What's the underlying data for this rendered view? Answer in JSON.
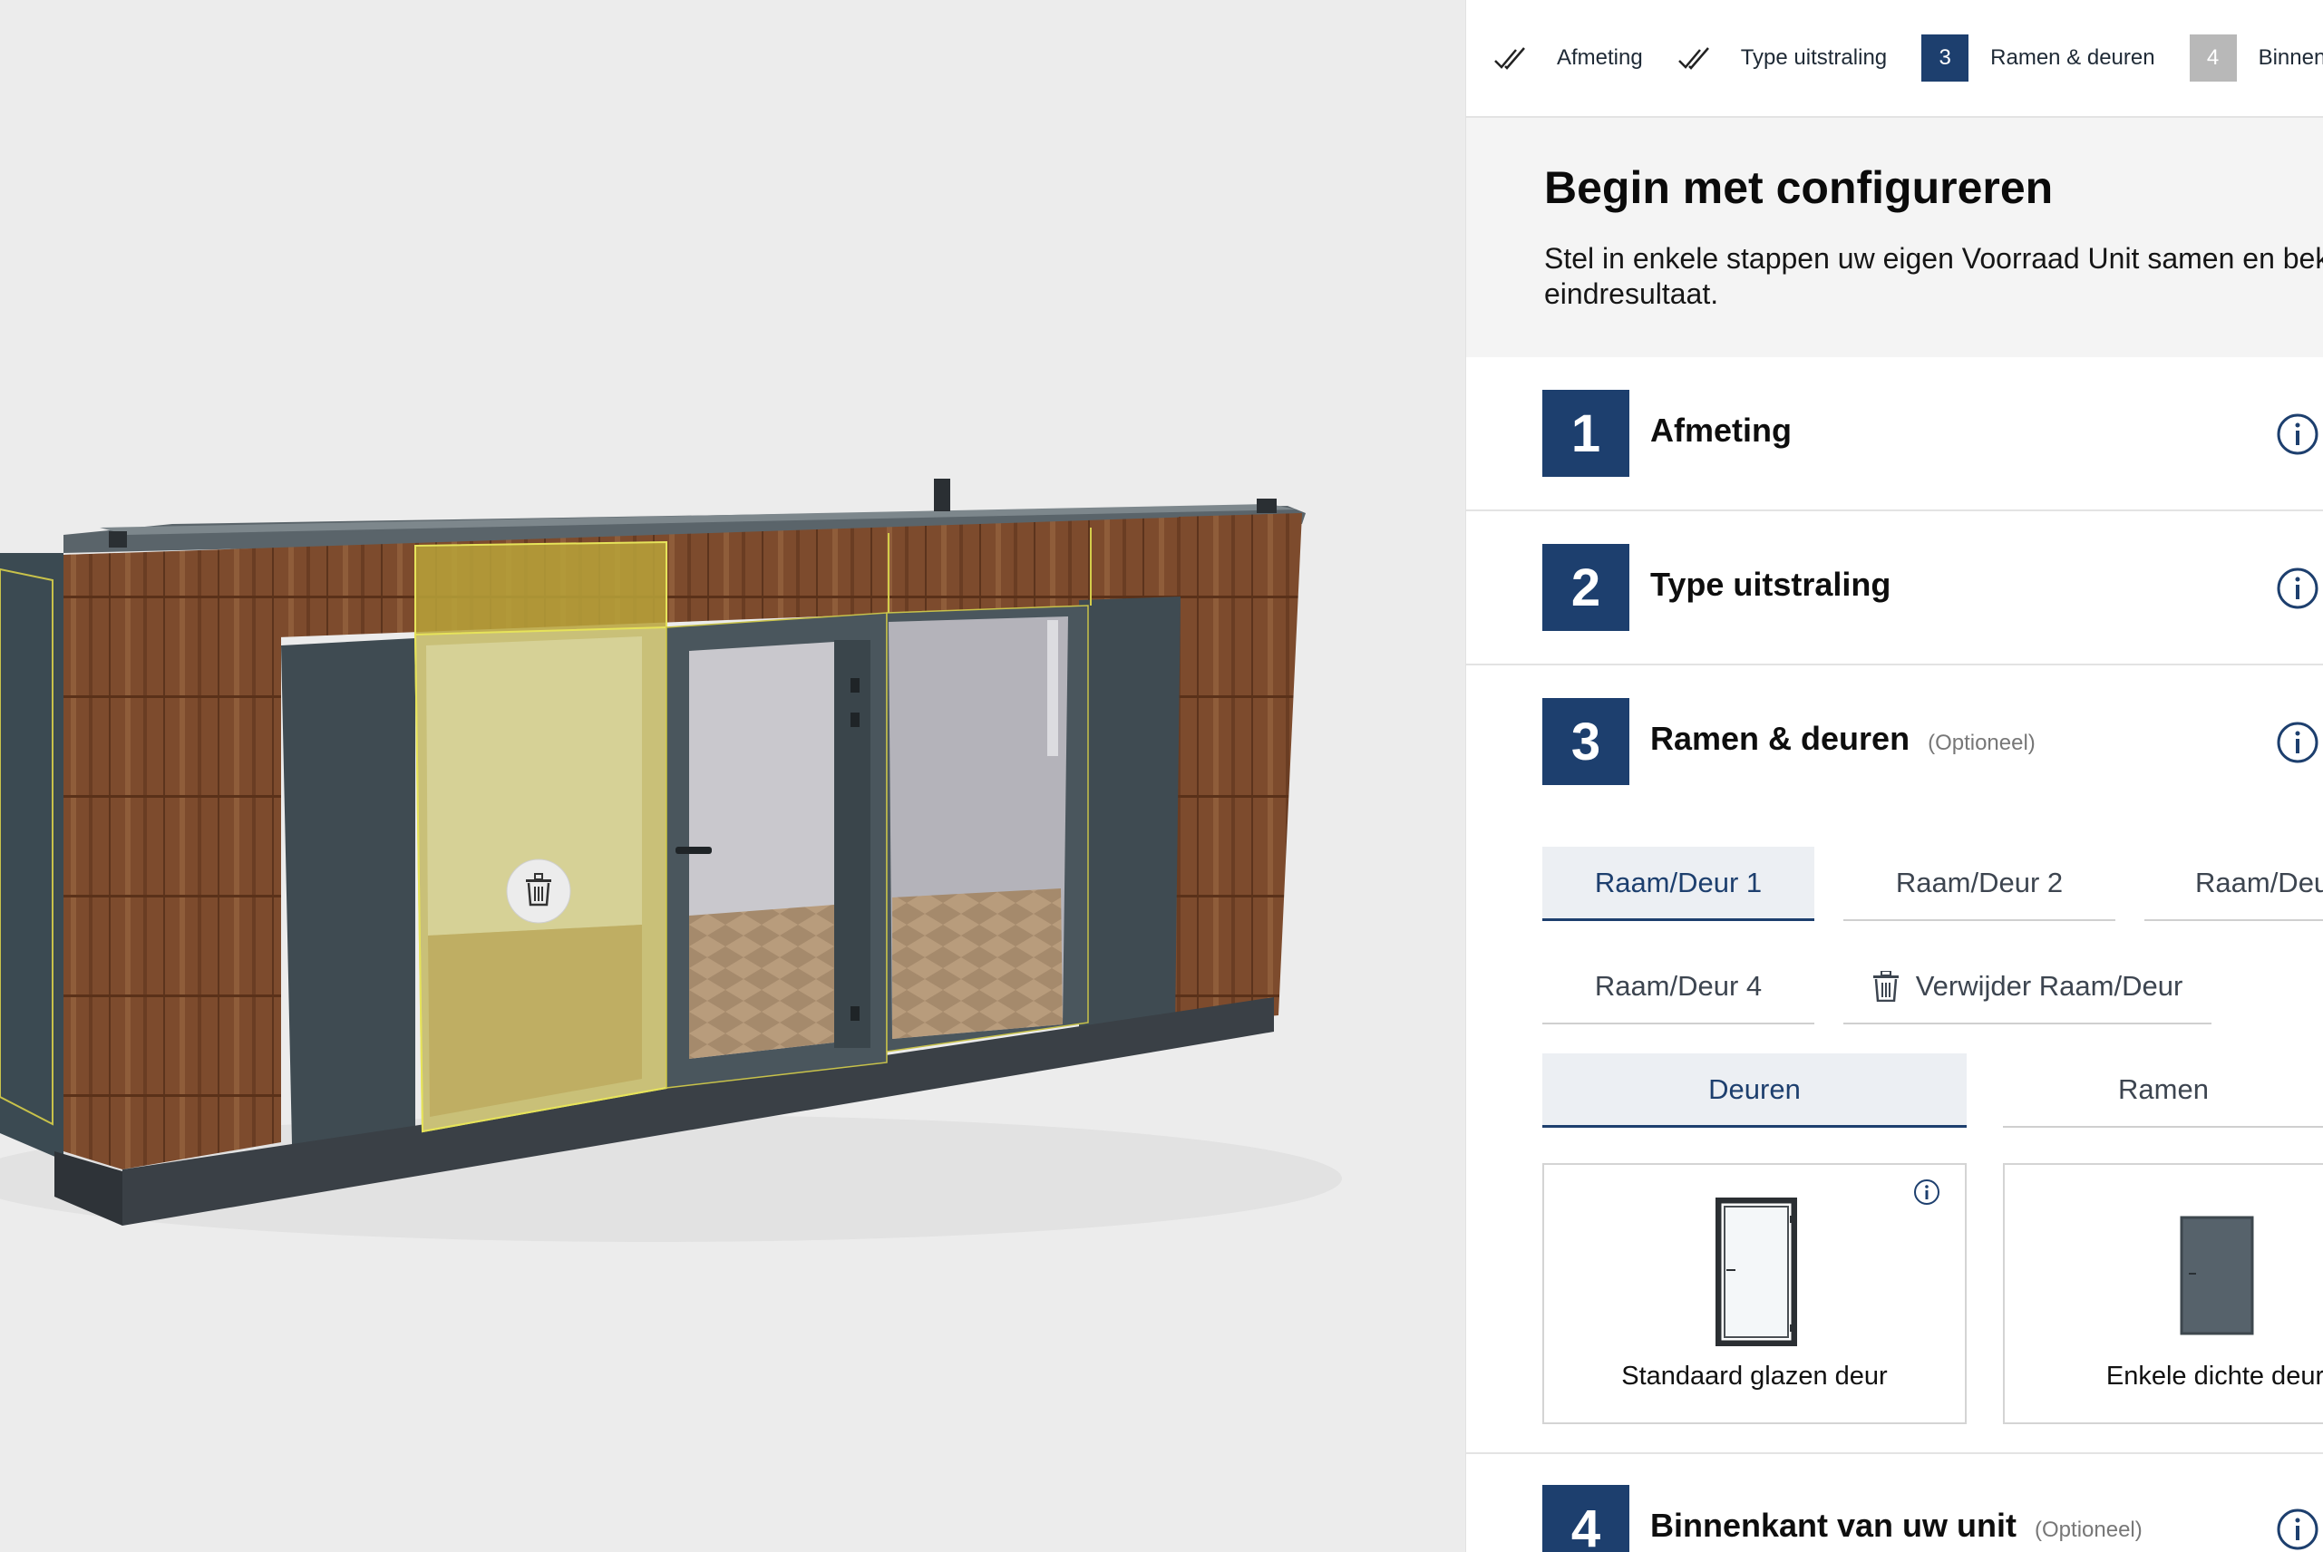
{
  "viewport": {
    "remove_icon": "trash-icon"
  },
  "stepper": {
    "steps": [
      {
        "num": "",
        "label": "Afmeting",
        "state": "done"
      },
      {
        "num": "",
        "label": "Type uitstraling",
        "state": "done"
      },
      {
        "num": "3",
        "label": "Ramen & deuren",
        "state": "active"
      },
      {
        "num": "4",
        "label": "Binnen",
        "state": "todo"
      }
    ]
  },
  "intro": {
    "title": "Begin met configureren",
    "text": "Stel in enkele stappen uw eigen Voorraad Unit samen en bekijk eindresultaat."
  },
  "sections": [
    {
      "num": "1",
      "title": "Afmeting",
      "optional": ""
    },
    {
      "num": "2",
      "title": "Type uitstraling",
      "optional": ""
    },
    {
      "num": "3",
      "title": "Ramen & deuren",
      "optional": "(Optioneel)"
    },
    {
      "num": "4",
      "title": "Binnenkant van uw unit",
      "optional": "(Optioneel)"
    }
  ],
  "item_tabs": {
    "items": [
      "Raam/Deur 1",
      "Raam/Deur 2",
      "Raam/Deu",
      "Raam/Deur 4"
    ],
    "selected": "Raam/Deur 1",
    "remove_label": "Verwijder Raam/Deur"
  },
  "type_tabs": {
    "items": [
      "Deuren",
      "Ramen"
    ],
    "selected": "Deuren"
  },
  "options": [
    {
      "label": "Standaard glazen deur"
    },
    {
      "label": "Enkele dichte deur"
    }
  ],
  "colors": {
    "primary": "#1d3f6e",
    "highlight": "#e6e35a",
    "wood": "#7a4a2c",
    "panel_dark": "#3e4b52"
  }
}
